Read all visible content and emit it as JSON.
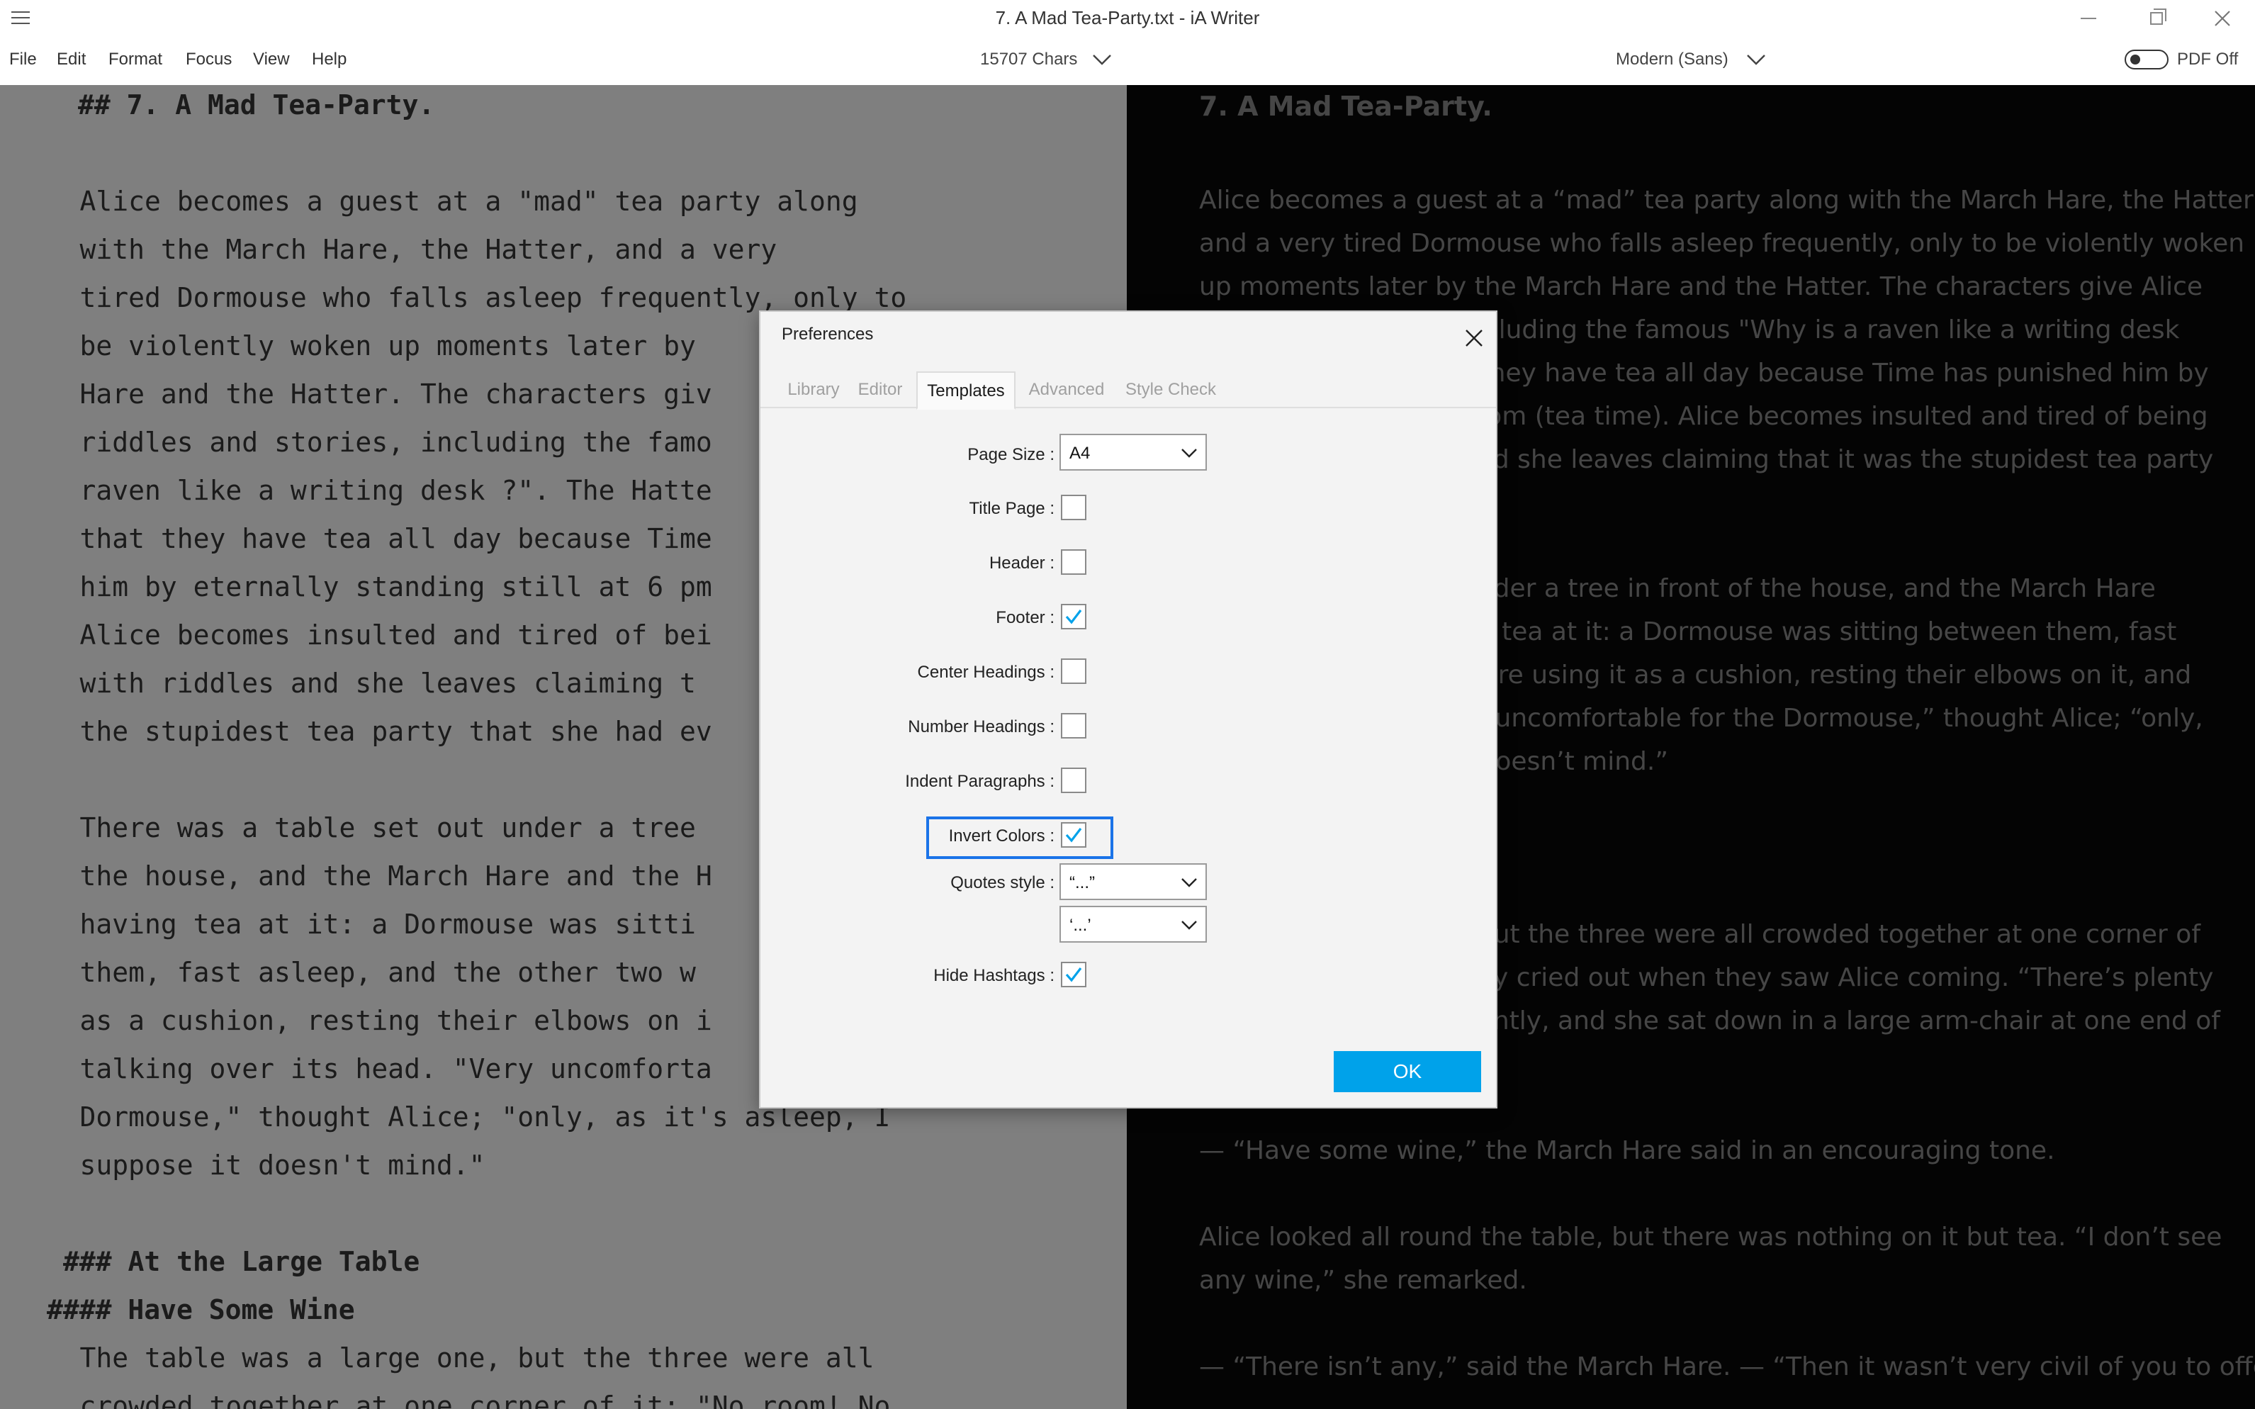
{
  "window": {
    "title": "7. A Mad Tea-Party.txt - iA Writer"
  },
  "menubar": {
    "items": [
      "File",
      "Edit",
      "Format",
      "Focus",
      "View",
      "Help"
    ],
    "char_count": "15707 Chars",
    "font": "Modern (Sans)",
    "pdf_label": "PDF Off"
  },
  "editor": {
    "lines": [
      "## 7. A Mad Tea-Party.",
      "    Alice becomes a guest at a \"mad\" tea party along",
      "    with the March Hare, the Hatter, and a very",
      "    tired Dormouse who falls asleep frequently, only to",
      "    be violently woken up moments later by",
      "    Hare and the Hatter. The characters giv",
      "    riddles and stories, including the famo",
      "    raven like a writing desk ?\". The Hatte",
      "    that they have tea all day because Time",
      "    him by eternally standing still at 6 pm",
      "    Alice becomes insulted and tired of bei",
      "    with riddles and she leaves claiming t",
      "    the stupidest tea party that she had ev",
      "    There was a table set out under a tree",
      "    the house, and the March Hare and the H",
      "    having tea at it: a Dormouse was sitti",
      "    them, fast asleep, and the other two w",
      "    as a cushion, resting their elbows on i",
      "    talking over its head. \"Very uncomforta",
      "    Dormouse,\" thought Alice; \"only, as it's asleep, I",
      "    suppose it doesn't mind.\"",
      "### At the Large Table",
      "#### Have Some Wine",
      "    The table was a large one, but the three were all",
      "    crowded together at one corner of it: \"No room! No"
    ]
  },
  "preview": {
    "heading": "7. A Mad Tea-Party.",
    "lines": [
      "Alice becomes a guest at a “mad” tea party along with the March Hare, the Hatter,",
      "and a very tired Dormouse who falls asleep frequently, only to be violently woken",
      "up moments later by the March Hare and the Hatter. The characters give Alice",
      "including the famous \"Why is a raven like a writing desk",
      "t they have tea all day because Time has punished him by",
      "6 pm (tea time). Alice becomes insulted and tired of being",
      "and she leaves claiming that it was the stupidest tea party",
      ".",
      "under a tree in front of the house, and the March Hare",
      "ng tea at it: a Dormouse was sitting between them, fast",
      "were using it as a cushion, resting their elbows on it, and",
      "ry uncomfortable for the Dormouse,” thought Alice; “only,",
      "t doesn’t mind.”",
      ", but the three were all crowded together at one corner of",
      "hey cried out when they saw Alice coming. “There’s plenty",
      "nantly, and she sat down in a large arm-chair at one end of",
      "— “Have some wine,” the March Hare said in an encouraging tone.",
      "Alice looked all round the table, but there was nothing on it but tea. “I don’t see",
      "any wine,” she remarked.",
      "— “There isn’t any,” said the March Hare. — “Then it wasn’t very civil of you to offer"
    ]
  },
  "dialog": {
    "title": "Preferences",
    "tabs": [
      "Library",
      "Editor",
      "Templates",
      "Advanced",
      "Style Check"
    ],
    "active_tab": "Templates",
    "page_size": {
      "label": "Page Size :",
      "value": "A4"
    },
    "checkboxes": [
      {
        "label": "Title Page :",
        "checked": false
      },
      {
        "label": "Header :",
        "checked": false
      },
      {
        "label": "Footer :",
        "checked": true
      },
      {
        "label": "Center Headings :",
        "checked": false
      },
      {
        "label": "Number Headings :",
        "checked": false
      },
      {
        "label": "Indent Paragraphs :",
        "checked": false
      },
      {
        "label": "Invert Colors :",
        "checked": true
      }
    ],
    "quotes_style": {
      "label": "Quotes style :",
      "double": "“...”",
      "single": "‘...’"
    },
    "hide_hashtags": {
      "label": "Hide Hashtags :",
      "checked": true
    },
    "ok_label": "OK"
  },
  "colors": {
    "accent": "#00a2ea",
    "focus_outline": "#1a73e8",
    "editor_bg": "#7f7f7f",
    "preview_bg": "#040404"
  }
}
